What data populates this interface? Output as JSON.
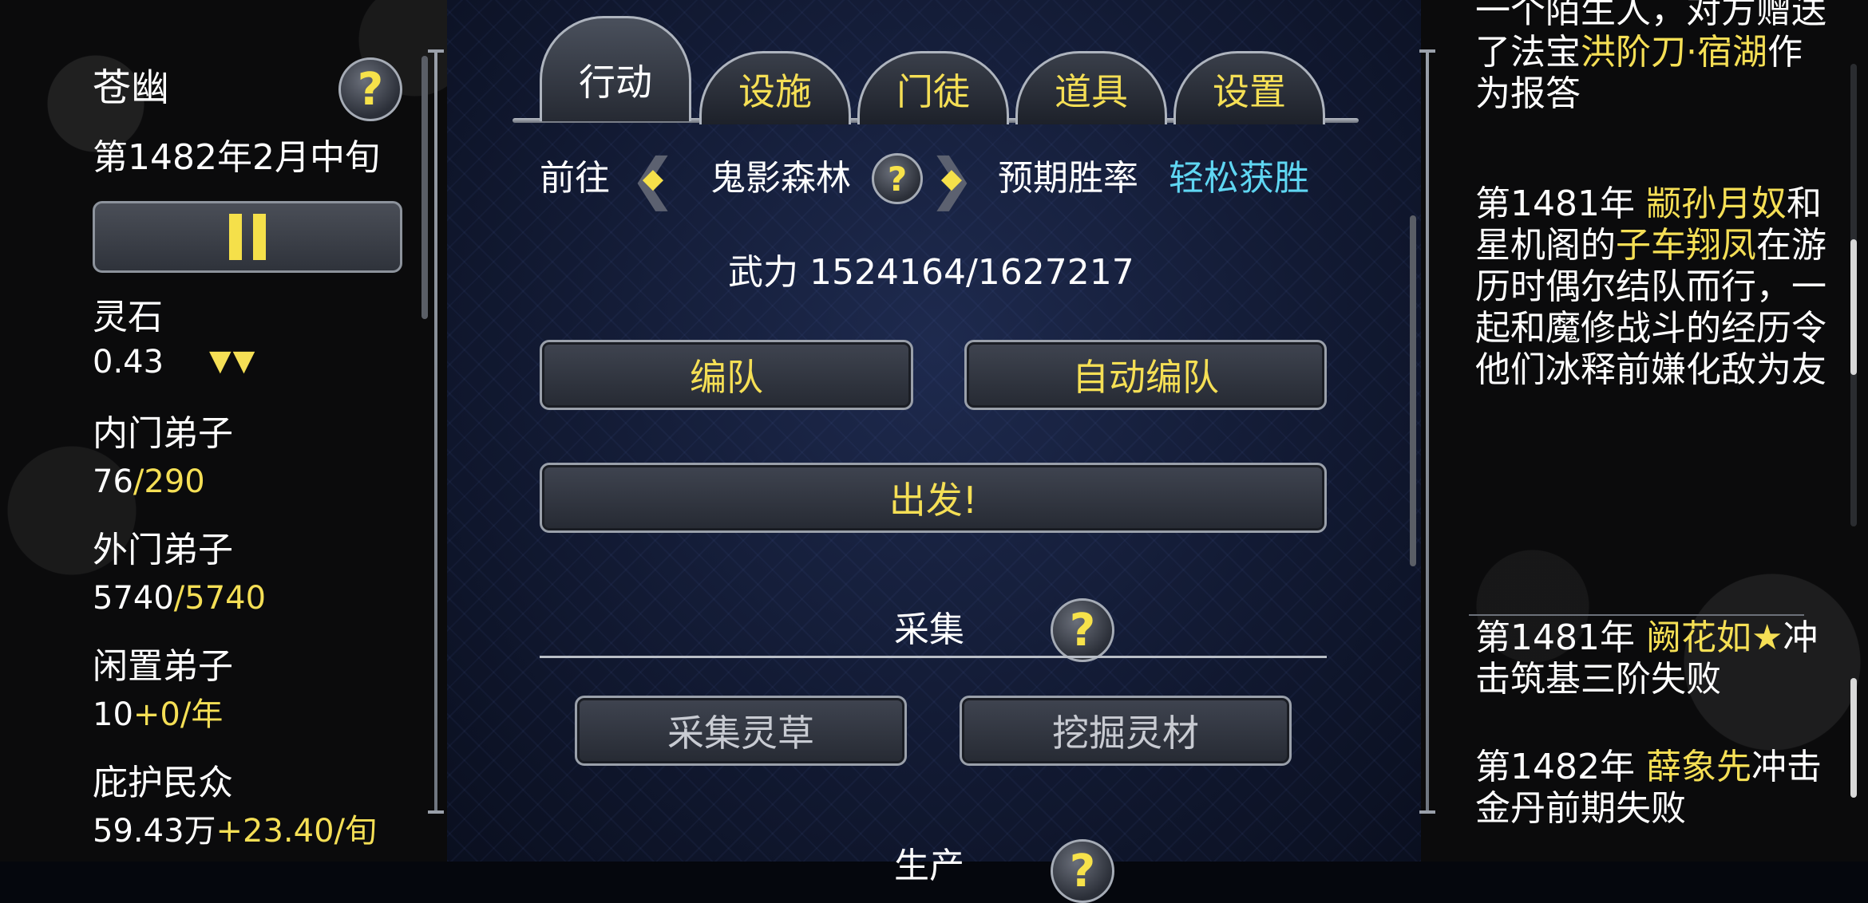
{
  "sect": {
    "name": "苍幽",
    "date": "第1482年2月中旬",
    "pause_icon": "pause-icon"
  },
  "stats": {
    "spirit_stone_label": "灵石",
    "spirit_stone_value": "0.43",
    "spirit_stone_trend": "▼▼",
    "inner_label": "内门弟子",
    "inner_current": "76",
    "inner_max": "/290",
    "outer_label": "外门弟子",
    "outer_current": "5740",
    "outer_max": "/5740",
    "idle_label": "闲置弟子",
    "idle_value": "10",
    "idle_rate": "+0/年",
    "protected_label": "庇护民众",
    "protected_value": "59.43万",
    "protected_rate": "+23.40/旬"
  },
  "tabs": [
    {
      "label": "行动",
      "active": true
    },
    {
      "label": "设施",
      "active": false
    },
    {
      "label": "门徒",
      "active": false
    },
    {
      "label": "道具",
      "active": false
    },
    {
      "label": "设置",
      "active": false
    }
  ],
  "action": {
    "goto_label": "前往",
    "location": "鬼影森林",
    "win_label": "预期胜率",
    "win_value": "轻松获胜",
    "power_label": "武力",
    "power_value": "1524164/1627217",
    "formation_button": "编队",
    "auto_formation_button": "自动编队",
    "depart_button": "出发!"
  },
  "gather": {
    "title": "采集",
    "herb_button": "采集灵草",
    "dig_button": "挖掘灵材",
    "next_section_partial": "生产"
  },
  "help_icon": "?",
  "log": [
    {
      "parts": [
        {
          "text": "一个陌生人，对方赠送了法宝",
          "highlight": false
        },
        {
          "text": "洪阶刀·宿湖",
          "highlight": true
        },
        {
          "text": "作为报答",
          "highlight": false
        }
      ]
    },
    {
      "parts": [
        {
          "text": "第1481年 ",
          "highlight": false
        },
        {
          "text": "颛孙月奴",
          "highlight": true
        },
        {
          "text": "和星机阁的",
          "highlight": false
        },
        {
          "text": "子车翔凤",
          "highlight": true
        },
        {
          "text": "在游历时偶尔结队而行，一起和魔修战斗的经历令他们冰释前嫌化敌为友",
          "highlight": false
        }
      ]
    },
    {
      "parts": [
        {
          "text": "第1481年 ",
          "highlight": false
        },
        {
          "text": "阙花如★",
          "highlight": true
        },
        {
          "text": "冲击筑基三阶失败",
          "highlight": false
        }
      ]
    },
    {
      "parts": [
        {
          "text": "第1482年 ",
          "highlight": false
        },
        {
          "text": "薛象先",
          "highlight": true
        },
        {
          "text": "冲击金丹前期失败",
          "highlight": false
        }
      ]
    }
  ]
}
